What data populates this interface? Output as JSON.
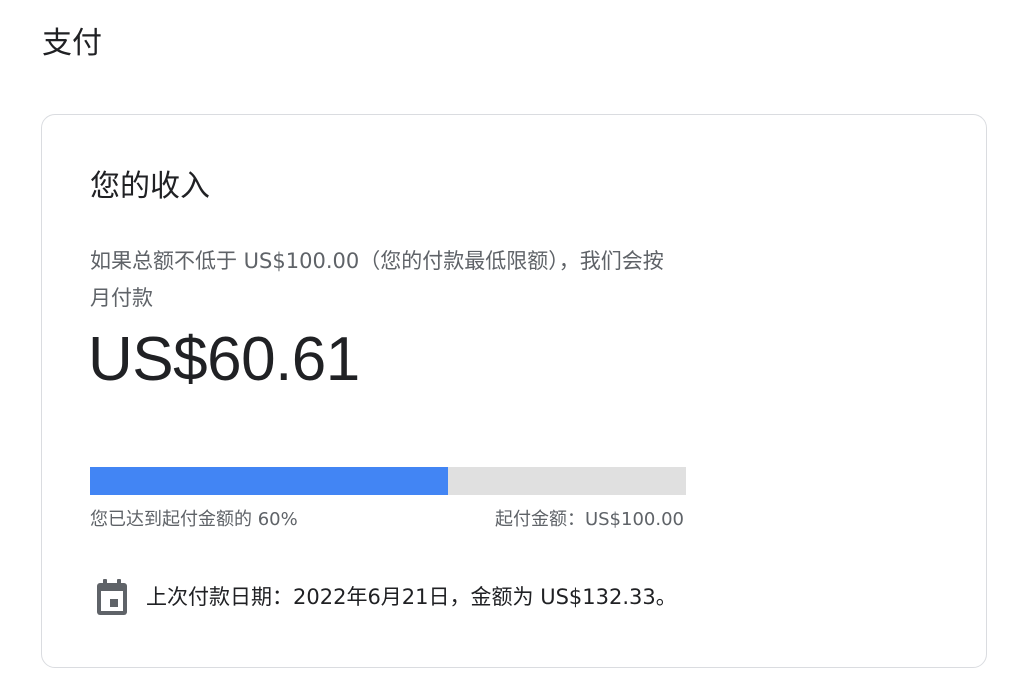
{
  "page": {
    "title": "支付"
  },
  "earnings_card": {
    "title": "您的收入",
    "description": "如果总额不低于 US$100.00（您的付款最低限额），我们会按月付款",
    "amount": "US$60.61",
    "progress": {
      "percent": 60,
      "left_label": "您已达到起付金额的 60%",
      "right_label": "起付金额：US$100.00"
    },
    "last_payment": {
      "icon": "calendar-icon",
      "text": "上次付款日期：2022年6月21日，金额为 US$132.33。"
    }
  },
  "colors": {
    "progress_fill": "#4285f4",
    "progress_track": "#e0e0e0",
    "text_primary": "#202124",
    "text_secondary": "#5f6368",
    "card_border": "#dadce0"
  }
}
